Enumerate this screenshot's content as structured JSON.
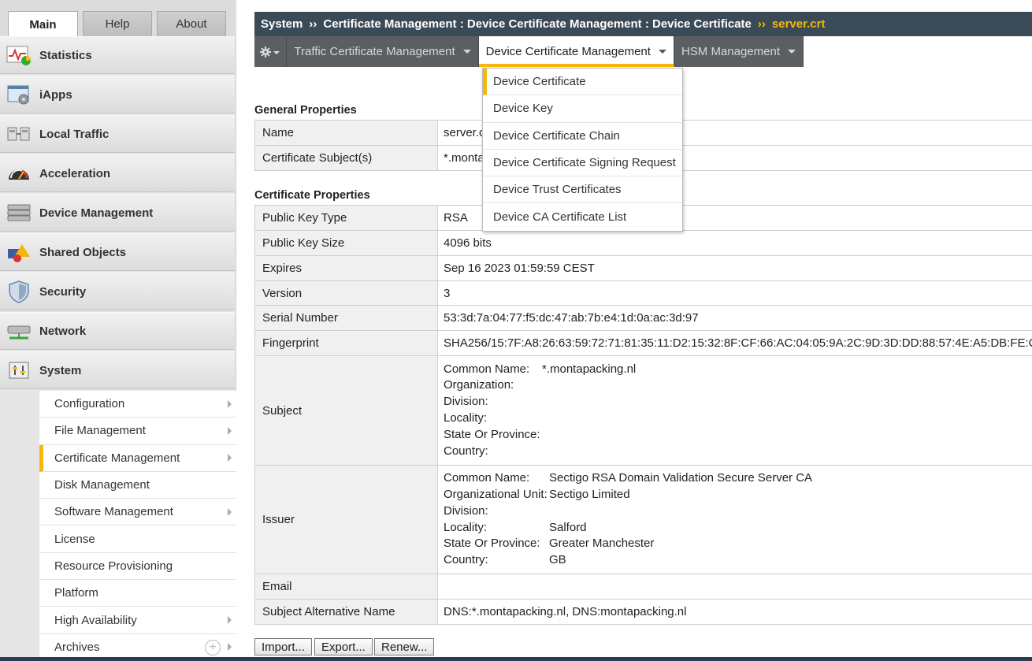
{
  "tabs": {
    "main": "Main",
    "help": "Help",
    "about": "About"
  },
  "nav": {
    "items": [
      {
        "label": "Statistics",
        "icon": "statistics-icon"
      },
      {
        "label": "iApps",
        "icon": "iapps-icon"
      },
      {
        "label": "Local Traffic",
        "icon": "local-traffic-icon"
      },
      {
        "label": "Acceleration",
        "icon": "acceleration-icon"
      },
      {
        "label": "Device Management",
        "icon": "device-management-icon"
      },
      {
        "label": "Shared Objects",
        "icon": "shared-objects-icon"
      },
      {
        "label": "Security",
        "icon": "security-icon"
      },
      {
        "label": "Network",
        "icon": "network-icon"
      },
      {
        "label": "System",
        "icon": "system-icon"
      }
    ],
    "system_sub": [
      {
        "label": "Configuration"
      },
      {
        "label": "File Management"
      },
      {
        "label": "Certificate Management"
      },
      {
        "label": "Disk Management"
      },
      {
        "label": "Software Management"
      },
      {
        "label": "License"
      },
      {
        "label": "Resource Provisioning"
      },
      {
        "label": "Platform"
      },
      {
        "label": "High Availability"
      },
      {
        "label": "Archives"
      }
    ]
  },
  "breadcrumb": {
    "part1": "System",
    "sep": "››",
    "part2": "Certificate Management : Device Certificate Management : Device Certificate",
    "current": "server.crt"
  },
  "menubar": {
    "items": [
      {
        "label": "Traffic Certificate Management"
      },
      {
        "label": "Device Certificate Management"
      },
      {
        "label": "HSM Management"
      }
    ]
  },
  "dropdown": {
    "items": [
      {
        "label": "Device Certificate"
      },
      {
        "label": "Device Key"
      },
      {
        "label": "Device Certificate Chain"
      },
      {
        "label": "Device Certificate Signing Request"
      },
      {
        "label": "Device Trust Certificates"
      },
      {
        "label": "Device CA Certificate List"
      }
    ]
  },
  "general": {
    "title": "General Properties",
    "name_label": "Name",
    "name_value": "server.crt",
    "subjects_label": "Certificate Subject(s)",
    "subjects_value": "*.montapacking.nl"
  },
  "cert": {
    "title": "Certificate Properties",
    "pubkey_type_label": "Public Key Type",
    "pubkey_type_value": "RSA",
    "pubkey_size_label": "Public Key Size",
    "pubkey_size_value": "4096 bits",
    "expires_label": "Expires",
    "expires_value": "Sep 16 2023 01:59:59 CEST",
    "version_label": "Version",
    "version_value": "3",
    "serial_label": "Serial Number",
    "serial_value": "53:3d:7a:04:77:f5:dc:47:ab:7b:e4:1d:0a:ac:3d:97",
    "fingerprint_label": "Fingerprint",
    "fingerprint_value": "SHA256/15:7F:A8:26:63:59:72:71:81:35:11:D2:15:32:8F:CF:66:AC:04:05:9A:2C:9D:3D:DD:88:57:4E:A5:DB:FE:C",
    "subject_label": "Subject",
    "subject": {
      "cn_k": "Common Name:",
      "cn_v": "*.montapacking.nl",
      "o_k": "Organization:",
      "o_v": "",
      "div_k": "Division:",
      "div_v": "",
      "loc_k": "Locality:",
      "loc_v": "",
      "st_k": "State Or Province:",
      "st_v": "",
      "c_k": "Country:",
      "c_v": ""
    },
    "issuer_label": "Issuer",
    "issuer": {
      "cn_k": "Common Name:",
      "cn_v": "Sectigo RSA Domain Validation Secure Server CA",
      "ou_k": "Organizational Unit:",
      "ou_v": "Sectigo Limited",
      "div_k": "Division:",
      "div_v": "",
      "loc_k": "Locality:",
      "loc_v": "Salford",
      "st_k": "State Or Province:",
      "st_v": "Greater Manchester",
      "c_k": "Country:",
      "c_v": "GB"
    },
    "email_label": "Email",
    "email_value": "",
    "san_label": "Subject Alternative Name",
    "san_value": "DNS:*.montapacking.nl, DNS:montapacking.nl"
  },
  "buttons": {
    "import": "Import...",
    "export": "Export...",
    "renew": "Renew..."
  },
  "colors": {
    "accent": "#f5b80a",
    "header": "#3b4a57",
    "menubar": "#5b5f63"
  }
}
